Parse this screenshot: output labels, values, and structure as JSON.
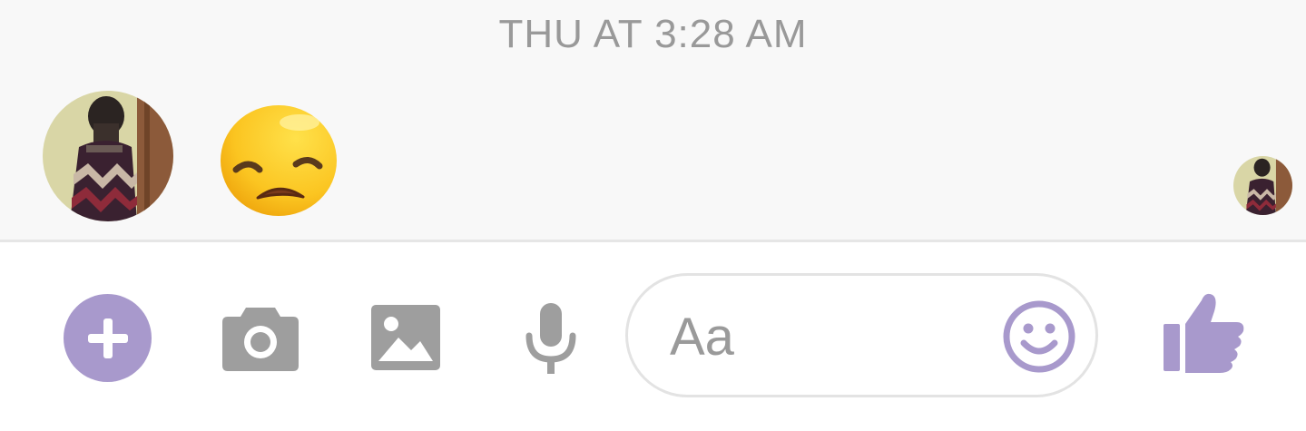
{
  "conversation": {
    "timestamp": "THU AT 3:28 AM",
    "messages": [
      {
        "sender": "other",
        "content_type": "emoji",
        "emoji_name": "disappointed-face-emoji"
      }
    ],
    "read_receipt": {
      "icon": "avatar"
    }
  },
  "composer": {
    "add_icon": "plus-icon",
    "camera_icon": "camera-icon",
    "gallery_icon": "image-icon",
    "mic_icon": "microphone-icon",
    "input_placeholder": "Aa",
    "emoji_icon": "smiley-icon",
    "like_icon": "thumbs-up-icon"
  },
  "colors": {
    "accent": "#a899cc",
    "icon_gray": "#9e9e9e",
    "chat_background": "#f8f8f8",
    "timestamp_text": "#999999"
  }
}
